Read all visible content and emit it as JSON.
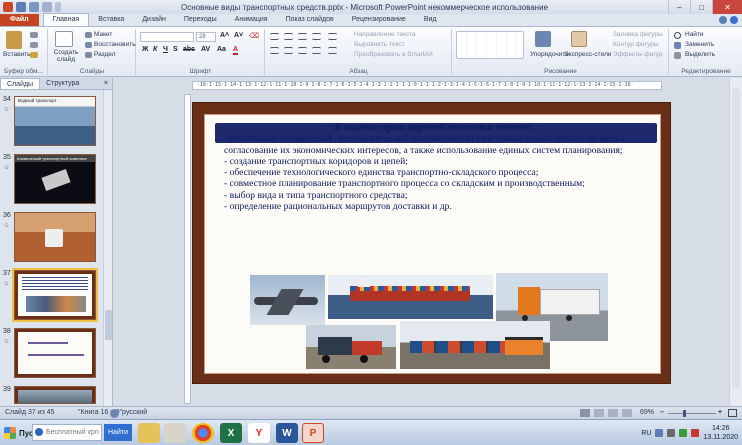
{
  "window": {
    "title": "Основные виды транспортных средств.pptx - Microsoft PowerPoint некоммерческое использование"
  },
  "ribbon_tabs": [
    "Файл",
    "Главная",
    "Вставка",
    "Дизайн",
    "Переходы",
    "Анимация",
    "Показ слайдов",
    "Рецензирование",
    "Вид"
  ],
  "ribbon": {
    "clipboard": {
      "paste": "Вставить",
      "label": "Буфер обм..."
    },
    "slides": {
      "create": "Создать слайд",
      "layout": "Макет",
      "reset": "Восстановить",
      "section": "Раздел",
      "label": "Слайды"
    },
    "font": {
      "font_size": "28",
      "label": "Шрифт"
    },
    "paragraph": {
      "text_direction": "Направление текста",
      "align_text": "Выровнять текст",
      "smartart": "Преобразовать в SmartArt",
      "label": "Абзац"
    },
    "drawing": {
      "arrange": "Упорядочить",
      "quick_styles": "Экспресс-стили",
      "shape_fill": "Заливка фигуры",
      "shape_outline": "Контур фигуры",
      "shape_effects": "Эффекты фигур",
      "label": "Рисование"
    },
    "editing": {
      "find": "Найти",
      "replace": "Заменить",
      "select": "Выделить",
      "label": "Редактирование"
    }
  },
  "left_panel": {
    "tabs": [
      "Слайды",
      "Структура"
    ],
    "close": "×",
    "thumbnails": [
      {
        "number": "34",
        "caption": "Водный транспорт"
      },
      {
        "number": "35",
        "caption": "Космический транспортный комплекс"
      },
      {
        "number": "36",
        "caption": ""
      },
      {
        "number": "37",
        "caption": ""
      },
      {
        "number": "38",
        "caption": ""
      },
      {
        "number": "39",
        "caption": ""
      }
    ]
  },
  "ruler": {
    "marks": "·16·1·15·1·14·1·13·1·12·1·11·1·10·1·9·1·8·1·7·1·6·1·5·1·4·1·3·1·2·1·1·1·0·1·1·1·2·1·3·1·4·1·5·1·6·1·7·1·8·1·9·1·10·1·11·1·12·1·13·1·14·1·15·1·16·"
  },
  "slide": {
    "heading": "К задачам транспортной логистики относят:",
    "lines": [
      "-обеспечение технической , технологической сопряженности участников транспортного процесса, согласование их экономических интересов, а также использование единых систем планирования;",
      "- создание транспортных коридоров и цепей;",
      "- обеспечение технологического единства транспортно-складского процесса;",
      "- совместное планирование транспортного процесса со складским и производственным;",
      "- выбор вида и типа транспортного средства;",
      "- определение рациональных маршрутов доставки  и др."
    ]
  },
  "status": {
    "slide_of": "Слайд 37 из 45",
    "theme": "\"Книга 16 x 9\"",
    "language": "русский",
    "zoom": "69%",
    "zoom_level": 0.69
  },
  "taskbar": {
    "start": "Пуск",
    "search_placeholder": "Бесплатный vpn",
    "find_button": "Найти",
    "lang": "RU",
    "time": "14:26",
    "date": "13.11.2020"
  },
  "colors": {
    "slide_frame": "#6a2f17",
    "slide_text": "#0c1a5e",
    "file_tab": "#c6441f"
  }
}
